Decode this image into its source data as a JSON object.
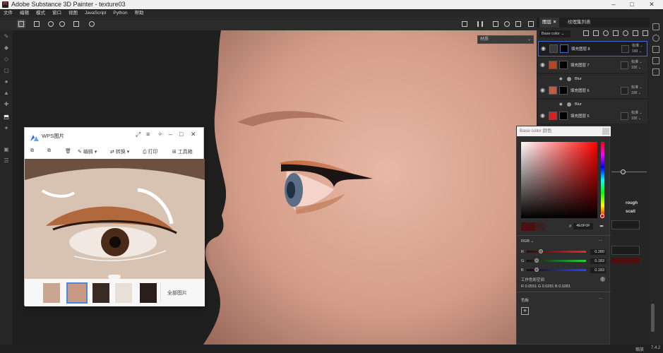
{
  "titlebar": {
    "title": "Adobe Substance 3D Painter - texture03",
    "logo_icon": "substance-logo-icon"
  },
  "menu": [
    "文件",
    "编辑",
    "模式",
    "窗口",
    "视图",
    "JavaScript",
    "Python",
    "帮助"
  ],
  "viewport": {
    "dropdown_value": "材质"
  },
  "right_tabs": {
    "layers": "图层",
    "texture_sets": "纹理集列表"
  },
  "layer_panel": {
    "channel_select": "Base color",
    "layers": [
      {
        "name": "填充图层 8",
        "blend": "标准",
        "opacity": "100",
        "color": "#3a3a3a"
      },
      {
        "name": "填充图层 7",
        "blend": "标准",
        "opacity": "100",
        "color": "#b8451f"
      },
      {
        "name": "填充图层 6",
        "blend": "标准",
        "opacity": "100",
        "color": "#c05a4a"
      },
      {
        "name": "填充图层 5",
        "blend": "标准",
        "opacity": "100",
        "color": "#d42222"
      }
    ],
    "filters": [
      "Blur",
      "Blur"
    ]
  },
  "props": {
    "rough": "rough",
    "scatt": "scatt"
  },
  "color_picker": {
    "title": "Base color 颜色",
    "hex": "4E0F0F",
    "mode": "RGB",
    "r": "0.280",
    "g": "0.183",
    "b": "0.183",
    "workspace_label": "工作色彩空间",
    "linear_values": "R 0.0551  G 0.0281  B 0.0281",
    "swatches_label": "色板"
  },
  "wps": {
    "title": "WPS图片",
    "toolbar": {
      "edit": "编辑",
      "convert": "转换",
      "print": "打印",
      "tools": "工具箱"
    },
    "all_images": "全部图片"
  },
  "status": {
    "version": "7.4.2",
    "zoom_label": "缩放"
  },
  "colors": {
    "accent": "#3b6fd0",
    "bg": "#1d1d1d",
    "skin": "#d8a894"
  }
}
